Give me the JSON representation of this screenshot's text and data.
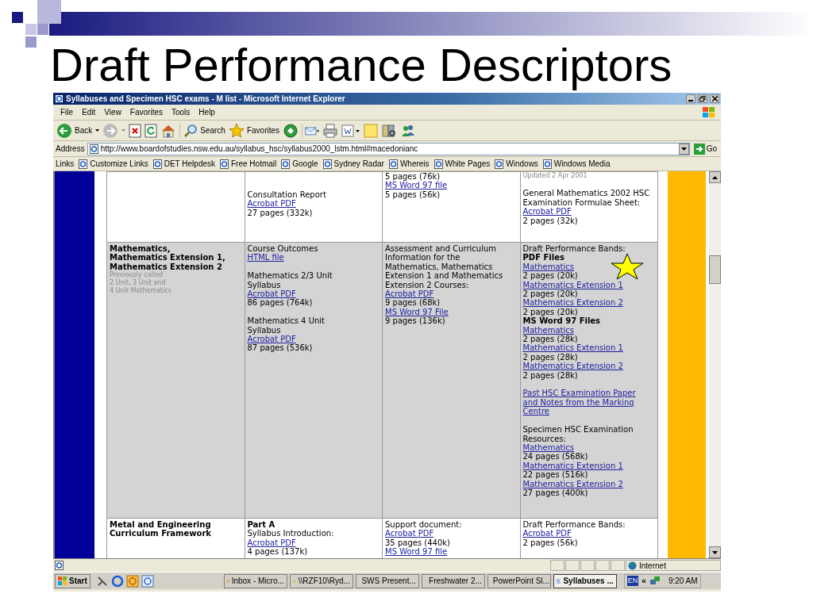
{
  "slide": {
    "title": "Draft Performance Descriptors"
  },
  "window": {
    "title": "Syllabuses and Specimen HSC exams - M list - Microsoft Internet Explorer"
  },
  "menu": [
    "File",
    "Edit",
    "View",
    "Favorites",
    "Tools",
    "Help"
  ],
  "toolbar": {
    "back": "Back",
    "search": "Search",
    "favorites": "Favorites"
  },
  "address": {
    "label": "Address",
    "url": "http://www.boardofstudies.nsw.edu.au/syllabus_hsc/syllabus2000_lstm.html#macedonianc",
    "go": "Go"
  },
  "links": {
    "label": "Links",
    "items": [
      "Customize Links",
      "DET Helpdesk",
      "Free Hotmail",
      "Google",
      "Sydney Radar",
      "Whereis",
      "White Pages",
      "Windows",
      "Windows Media"
    ]
  },
  "table": {
    "rows": [
      {
        "shaded": false,
        "cells": [
          [],
          [
            {
              "kind": "gap"
            },
            {
              "kind": "gap"
            },
            {
              "kind": "text",
              "text": "Consultation Report"
            },
            {
              "kind": "link",
              "text": "Acrobat PDF"
            },
            {
              "kind": "text",
              "text": "27 pages (332k)"
            }
          ],
          [
            {
              "kind": "text",
              "text": "5 pages (76k)"
            },
            {
              "kind": "link",
              "text": "MS Word 97 file"
            },
            {
              "kind": "text",
              "text": "5 pages (56k)"
            }
          ],
          [
            {
              "kind": "note",
              "text": "Updated 2 Apr 2001"
            },
            {
              "kind": "gap"
            },
            {
              "kind": "text",
              "text": "General Mathematics 2002 HSC\nExamination Formulae Sheet:"
            },
            {
              "kind": "link",
              "text": "Acrobat PDF"
            },
            {
              "kind": "text",
              "text": "2 pages (32k)"
            }
          ]
        ]
      },
      {
        "shaded": true,
        "cells": [
          [
            {
              "kind": "bold",
              "text": "Mathematics,\nMathematics Extension 1,\nMathematics Extension 2"
            },
            {
              "kind": "note",
              "text": "Previously called\n2 Unit, 3 Unit and\n4 Unit Mathematics"
            }
          ],
          [
            {
              "kind": "text",
              "text": "Course Outcomes"
            },
            {
              "kind": "link",
              "text": "HTML file"
            },
            {
              "kind": "gap"
            },
            {
              "kind": "text",
              "text": "Mathematics 2/3 Unit\nSyllabus"
            },
            {
              "kind": "link",
              "text": "Acrobat PDF"
            },
            {
              "kind": "text",
              "text": "86 pages (764k)"
            },
            {
              "kind": "gap"
            },
            {
              "kind": "text",
              "text": "Mathematics 4 Unit\nSyllabus"
            },
            {
              "kind": "link",
              "text": "Acrobat PDF"
            },
            {
              "kind": "text",
              "text": "87 pages (536k)"
            }
          ],
          [
            {
              "kind": "text",
              "text": "Assessment and Curriculum\nInformation for the\nMathematics, Mathematics\nExtension 1 and Mathematics\nExtension 2 Courses:"
            },
            {
              "kind": "link",
              "text": "Acrobat PDF"
            },
            {
              "kind": "text",
              "text": "9 pages (68k)"
            },
            {
              "kind": "link",
              "text": "MS Word 97 File"
            },
            {
              "kind": "text",
              "text": "9 pages (136k)"
            }
          ],
          [
            {
              "kind": "text",
              "text": "Draft Performance Bands:"
            },
            {
              "kind": "bold",
              "text": "PDF Files"
            },
            {
              "kind": "link",
              "text": "Mathematics"
            },
            {
              "kind": "text",
              "text": "2 pages (20k)"
            },
            {
              "kind": "link",
              "text": "Mathematics Extension 1"
            },
            {
              "kind": "text",
              "text": "2 pages (20k)"
            },
            {
              "kind": "link",
              "text": "Mathematics Extension 2"
            },
            {
              "kind": "text",
              "text": "2 pages (20k)"
            },
            {
              "kind": "bold",
              "text": "MS Word 97 Files"
            },
            {
              "kind": "link",
              "text": "Mathematics"
            },
            {
              "kind": "text",
              "text": "2 pages (28k)"
            },
            {
              "kind": "link",
              "text": "Mathematics Extension 1"
            },
            {
              "kind": "text",
              "text": "2 pages (28k)"
            },
            {
              "kind": "link",
              "text": "Mathematics Extension 2"
            },
            {
              "kind": "text",
              "text": "2 pages (28k)"
            },
            {
              "kind": "gap"
            },
            {
              "kind": "link",
              "text": "Past HSC Examination Paper\nand Notes from the Marking\nCentre"
            },
            {
              "kind": "gap"
            },
            {
              "kind": "text",
              "text": "Specimen HSC Examination\nResources:"
            },
            {
              "kind": "link",
              "text": "Mathematics"
            },
            {
              "kind": "text",
              "text": "24 pages (568k)"
            },
            {
              "kind": "link",
              "text": "Mathematics Extension 1"
            },
            {
              "kind": "text",
              "text": "22 pages (516k)"
            },
            {
              "kind": "link",
              "text": "Mathematics Extension 2"
            },
            {
              "kind": "text",
              "text": "27 pages (400k)"
            }
          ]
        ]
      },
      {
        "shaded": false,
        "cells": [
          [
            {
              "kind": "bold",
              "text": "Metal and Engineering\nCurriculum Framework"
            }
          ],
          [
            {
              "kind": "bold",
              "text": "Part A"
            },
            {
              "kind": "text",
              "text": "Syllabus Introduction:"
            },
            {
              "kind": "link",
              "text": "Acrobat PDF"
            },
            {
              "kind": "text",
              "text": "4 pages (137k)"
            }
          ],
          [
            {
              "kind": "text",
              "text": "Support document:"
            },
            {
              "kind": "link",
              "text": "Acrobat PDF"
            },
            {
              "kind": "text",
              "text": "35 pages (440k)"
            },
            {
              "kind": "link",
              "text": "MS Word 97 file"
            }
          ],
          [
            {
              "kind": "text",
              "text": "Draft Performance Bands:"
            },
            {
              "kind": "link",
              "text": "Acrobat PDF"
            },
            {
              "kind": "text",
              "text": "2 pages (56k)"
            }
          ]
        ]
      }
    ]
  },
  "status_bar": {
    "zone": "Internet"
  },
  "taskbar": {
    "start": "Start",
    "tasks": [
      {
        "label": "Inbox - Micro...",
        "selected": false
      },
      {
        "label": "\\\\RZF10\\Ryd...",
        "selected": false
      },
      {
        "label": "SWS Present...",
        "selected": false
      },
      {
        "label": "Freshwater 2...",
        "selected": false
      },
      {
        "label": "PowerPoint Sl...",
        "selected": false
      },
      {
        "label": "Syllabuses ...",
        "selected": true
      }
    ],
    "language": "EN",
    "expand": "«",
    "clock": "9:20 AM"
  }
}
